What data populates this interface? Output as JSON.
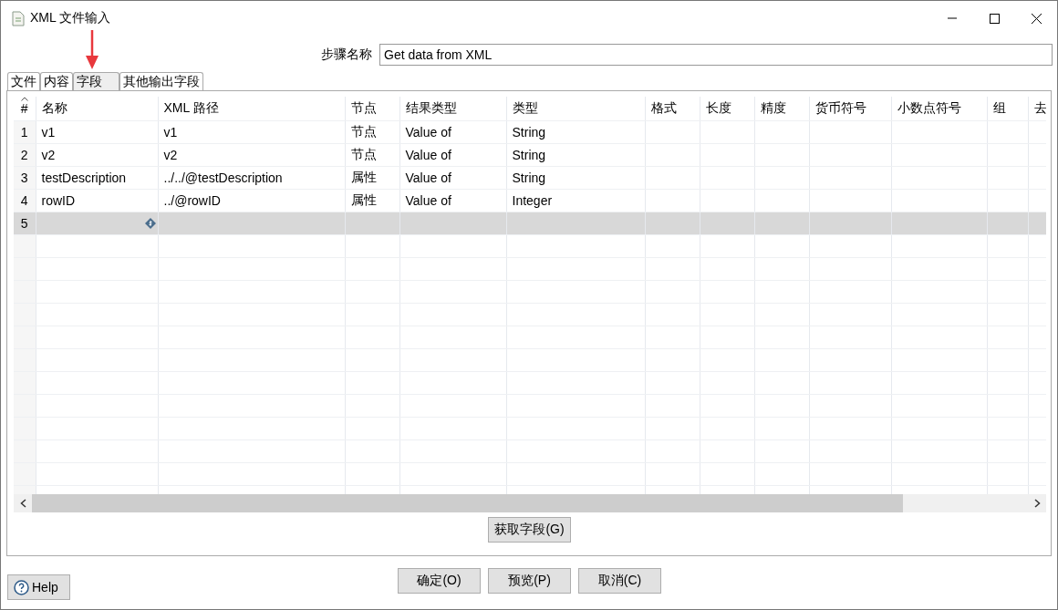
{
  "window": {
    "title": "XML 文件输入"
  },
  "step_name": {
    "label": "步骤名称",
    "value": "Get data from XML"
  },
  "tabs": [
    {
      "label": "文件",
      "selected": false
    },
    {
      "label": "内容",
      "selected": false
    },
    {
      "label": "字段",
      "selected": true
    },
    {
      "label": "其他输出字段",
      "selected": false
    }
  ],
  "table": {
    "columns": [
      "#",
      "名称",
      "XML 路径",
      "节点",
      "结果类型",
      "类型",
      "格式",
      "长度",
      "精度",
      "货币符号",
      "小数点符号",
      "组",
      "去"
    ],
    "rows": [
      {
        "selected": false,
        "editing": false,
        "cells": [
          "1",
          "v1",
          "v1",
          "节点",
          "Value of",
          "String"
        ]
      },
      {
        "selected": false,
        "editing": false,
        "cells": [
          "2",
          "v2",
          "v2",
          "节点",
          "Value of",
          "String"
        ]
      },
      {
        "selected": false,
        "editing": false,
        "cells": [
          "3",
          "testDescription",
          "../../@testDescription",
          "属性",
          "Value of",
          "String"
        ]
      },
      {
        "selected": false,
        "editing": false,
        "cells": [
          "4",
          "rowID",
          "../@rowID",
          "属性",
          "Value of",
          "Integer"
        ]
      },
      {
        "selected": true,
        "editing": true,
        "cells": [
          "5"
        ]
      }
    ]
  },
  "get_fields_button": "获取字段(G)",
  "help_button": "Help",
  "buttons": [
    "确定(O)",
    "预览(P)",
    "取消(C)"
  ]
}
